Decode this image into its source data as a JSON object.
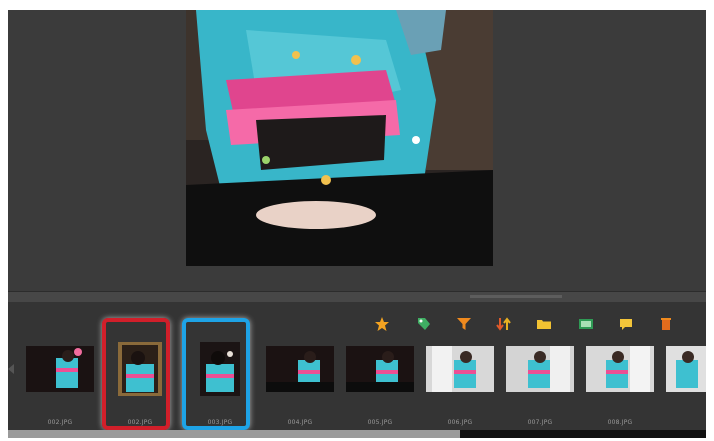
{
  "filmstrip": {
    "thumbnails": [
      {
        "label": "002.JPG"
      },
      {
        "label": "002.JPG"
      },
      {
        "label": "003.JPG"
      },
      {
        "label": "004.JPG"
      },
      {
        "label": "005.JPG"
      },
      {
        "label": "006.JPG"
      },
      {
        "label": "007.JPG"
      },
      {
        "label": "008.JPG"
      },
      {
        "label": ""
      }
    ],
    "toolbar_icons": [
      "star-icon",
      "tag-icon",
      "filter-icon",
      "sort-icon",
      "folder-icon",
      "slideshow-icon",
      "comment-icon",
      "trash-icon"
    ],
    "highlight_colors": {
      "red": "#d11f2a",
      "blue": "#1ea3e6"
    }
  }
}
